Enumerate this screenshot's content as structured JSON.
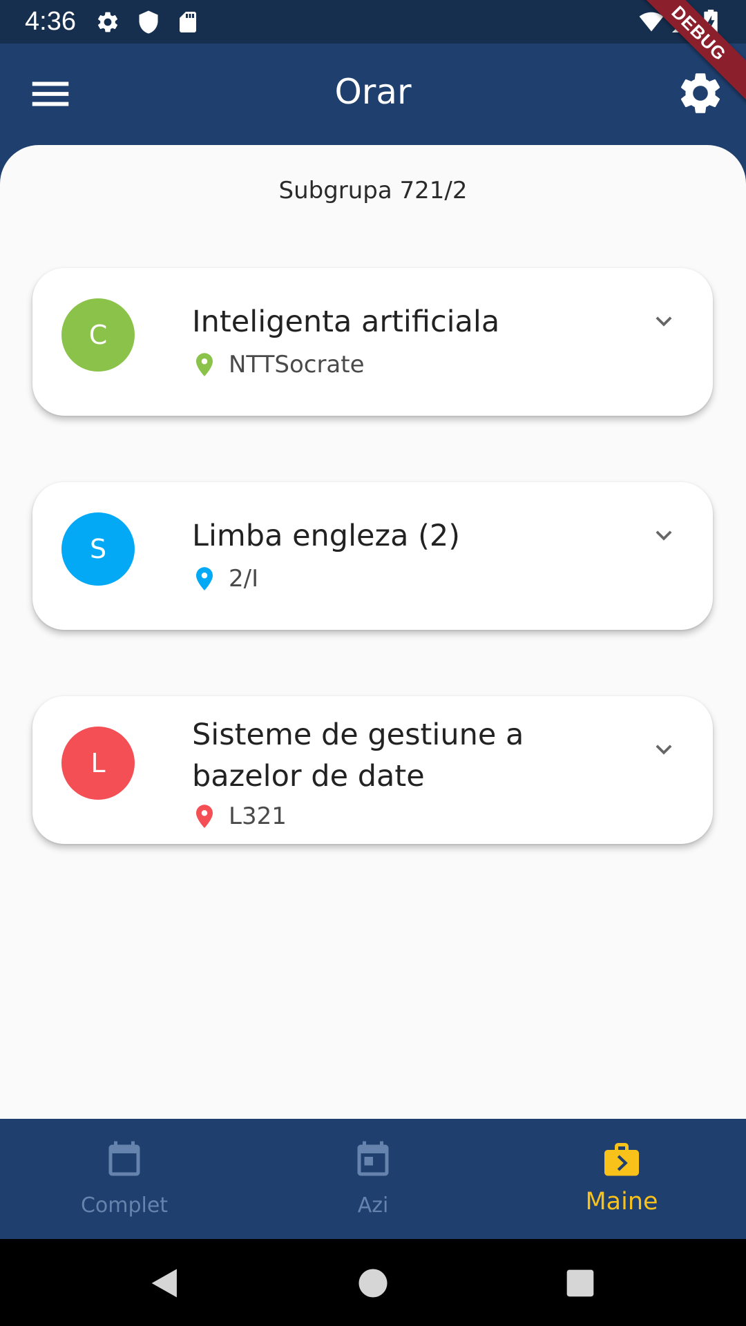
{
  "status_bar": {
    "time": "4:36",
    "left_icons": [
      "gear-icon",
      "shield-icon",
      "sd-card-icon"
    ],
    "right_icons": [
      "wifi-icon",
      "signal-icon",
      "battery-charging-icon"
    ],
    "debug_banner": "DEBUG"
  },
  "app_bar": {
    "title": "Orar",
    "menu_icon": "menu-icon",
    "settings_icon": "gear-icon"
  },
  "schedule": {
    "subgroup": "Subgrupa 721/2",
    "courses": [
      {
        "initial": "C",
        "name": "Inteligenta artificiala",
        "location": "NTTSocrate",
        "color": "#8bc34a"
      },
      {
        "initial": "S",
        "name": "Limba engleza (2)",
        "location": "2/I",
        "color": "#03a9f4"
      },
      {
        "initial": "L",
        "name": "Sisteme de gestiune a bazelor de date",
        "location": "L321",
        "color": "#f44f55"
      }
    ]
  },
  "bottom_nav": {
    "items": [
      {
        "label": "Complet",
        "icon": "calendar-icon",
        "active": false
      },
      {
        "label": "Azi",
        "icon": "calendar-today-icon",
        "active": false
      },
      {
        "label": "Maine",
        "icon": "next-day-briefcase-icon",
        "active": true
      }
    ],
    "active_color": "#f9c21a",
    "inactive_color": "#6583ad"
  },
  "system_nav": {
    "buttons": [
      "back-icon",
      "home-icon",
      "recents-icon"
    ]
  },
  "colors": {
    "primary": "#1f3f6e",
    "status_bar": "#172f4f",
    "background": "#fafafa"
  }
}
